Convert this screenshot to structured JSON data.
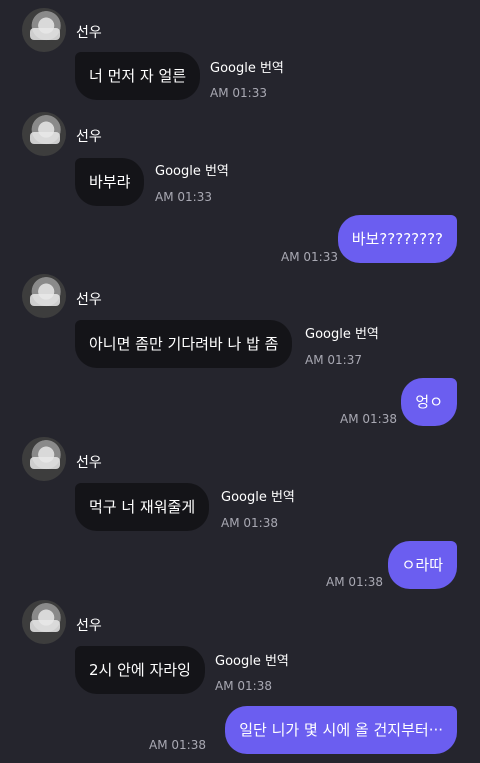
{
  "messages": [
    {
      "sender": "선우",
      "text": "너 먼저 자 얼른",
      "translate": "Google 번역",
      "time": "AM 01:33"
    },
    {
      "sender": "선우",
      "text": "바부랴",
      "translate": "Google 번역",
      "time": "AM 01:33"
    },
    {
      "text": "바보????????",
      "time": "AM 01:33"
    },
    {
      "sender": "선우",
      "text": "아니면 좀만 기다려바 나 밥 좀",
      "translate": "Google 번역",
      "time": "AM 01:37"
    },
    {
      "text": "엉ㅇ",
      "time": "AM 01:38"
    },
    {
      "sender": "선우",
      "text": "먹구 너 재워줄게",
      "translate": "Google 번역",
      "time": "AM 01:38"
    },
    {
      "text": "ㅇ라따",
      "time": "AM 01:38"
    },
    {
      "sender": "선우",
      "text": "2시 안에 자라잉",
      "translate": "Google 번역",
      "time": "AM 01:38"
    },
    {
      "text": "일단 니가 몇 시에 올 건지부터···",
      "time": "AM 01:38"
    }
  ]
}
